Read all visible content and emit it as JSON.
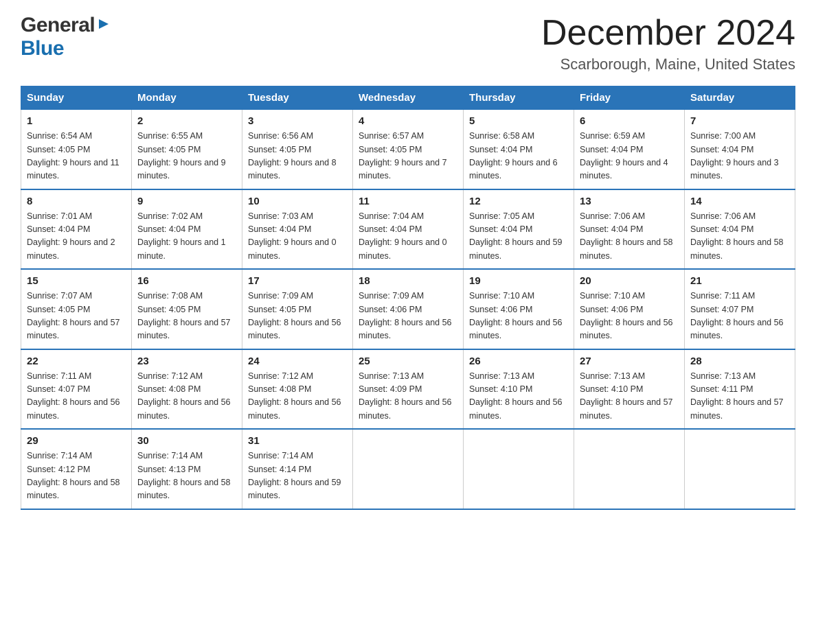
{
  "header": {
    "logo_general": "General",
    "logo_blue": "Blue",
    "month_title": "December 2024",
    "location": "Scarborough, Maine, United States"
  },
  "days_of_week": [
    "Sunday",
    "Monday",
    "Tuesday",
    "Wednesday",
    "Thursday",
    "Friday",
    "Saturday"
  ],
  "weeks": [
    [
      {
        "day": "1",
        "sunrise": "6:54 AM",
        "sunset": "4:05 PM",
        "daylight": "9 hours and 11 minutes."
      },
      {
        "day": "2",
        "sunrise": "6:55 AM",
        "sunset": "4:05 PM",
        "daylight": "9 hours and 9 minutes."
      },
      {
        "day": "3",
        "sunrise": "6:56 AM",
        "sunset": "4:05 PM",
        "daylight": "9 hours and 8 minutes."
      },
      {
        "day": "4",
        "sunrise": "6:57 AM",
        "sunset": "4:05 PM",
        "daylight": "9 hours and 7 minutes."
      },
      {
        "day": "5",
        "sunrise": "6:58 AM",
        "sunset": "4:04 PM",
        "daylight": "9 hours and 6 minutes."
      },
      {
        "day": "6",
        "sunrise": "6:59 AM",
        "sunset": "4:04 PM",
        "daylight": "9 hours and 4 minutes."
      },
      {
        "day": "7",
        "sunrise": "7:00 AM",
        "sunset": "4:04 PM",
        "daylight": "9 hours and 3 minutes."
      }
    ],
    [
      {
        "day": "8",
        "sunrise": "7:01 AM",
        "sunset": "4:04 PM",
        "daylight": "9 hours and 2 minutes."
      },
      {
        "day": "9",
        "sunrise": "7:02 AM",
        "sunset": "4:04 PM",
        "daylight": "9 hours and 1 minute."
      },
      {
        "day": "10",
        "sunrise": "7:03 AM",
        "sunset": "4:04 PM",
        "daylight": "9 hours and 0 minutes."
      },
      {
        "day": "11",
        "sunrise": "7:04 AM",
        "sunset": "4:04 PM",
        "daylight": "9 hours and 0 minutes."
      },
      {
        "day": "12",
        "sunrise": "7:05 AM",
        "sunset": "4:04 PM",
        "daylight": "8 hours and 59 minutes."
      },
      {
        "day": "13",
        "sunrise": "7:06 AM",
        "sunset": "4:04 PM",
        "daylight": "8 hours and 58 minutes."
      },
      {
        "day": "14",
        "sunrise": "7:06 AM",
        "sunset": "4:04 PM",
        "daylight": "8 hours and 58 minutes."
      }
    ],
    [
      {
        "day": "15",
        "sunrise": "7:07 AM",
        "sunset": "4:05 PM",
        "daylight": "8 hours and 57 minutes."
      },
      {
        "day": "16",
        "sunrise": "7:08 AM",
        "sunset": "4:05 PM",
        "daylight": "8 hours and 57 minutes."
      },
      {
        "day": "17",
        "sunrise": "7:09 AM",
        "sunset": "4:05 PM",
        "daylight": "8 hours and 56 minutes."
      },
      {
        "day": "18",
        "sunrise": "7:09 AM",
        "sunset": "4:06 PM",
        "daylight": "8 hours and 56 minutes."
      },
      {
        "day": "19",
        "sunrise": "7:10 AM",
        "sunset": "4:06 PM",
        "daylight": "8 hours and 56 minutes."
      },
      {
        "day": "20",
        "sunrise": "7:10 AM",
        "sunset": "4:06 PM",
        "daylight": "8 hours and 56 minutes."
      },
      {
        "day": "21",
        "sunrise": "7:11 AM",
        "sunset": "4:07 PM",
        "daylight": "8 hours and 56 minutes."
      }
    ],
    [
      {
        "day": "22",
        "sunrise": "7:11 AM",
        "sunset": "4:07 PM",
        "daylight": "8 hours and 56 minutes."
      },
      {
        "day": "23",
        "sunrise": "7:12 AM",
        "sunset": "4:08 PM",
        "daylight": "8 hours and 56 minutes."
      },
      {
        "day": "24",
        "sunrise": "7:12 AM",
        "sunset": "4:08 PM",
        "daylight": "8 hours and 56 minutes."
      },
      {
        "day": "25",
        "sunrise": "7:13 AM",
        "sunset": "4:09 PM",
        "daylight": "8 hours and 56 minutes."
      },
      {
        "day": "26",
        "sunrise": "7:13 AM",
        "sunset": "4:10 PM",
        "daylight": "8 hours and 56 minutes."
      },
      {
        "day": "27",
        "sunrise": "7:13 AM",
        "sunset": "4:10 PM",
        "daylight": "8 hours and 57 minutes."
      },
      {
        "day": "28",
        "sunrise": "7:13 AM",
        "sunset": "4:11 PM",
        "daylight": "8 hours and 57 minutes."
      }
    ],
    [
      {
        "day": "29",
        "sunrise": "7:14 AM",
        "sunset": "4:12 PM",
        "daylight": "8 hours and 58 minutes."
      },
      {
        "day": "30",
        "sunrise": "7:14 AM",
        "sunset": "4:13 PM",
        "daylight": "8 hours and 58 minutes."
      },
      {
        "day": "31",
        "sunrise": "7:14 AM",
        "sunset": "4:14 PM",
        "daylight": "8 hours and 59 minutes."
      },
      null,
      null,
      null,
      null
    ]
  ],
  "labels": {
    "sunrise_prefix": "Sunrise: ",
    "sunset_prefix": "Sunset: ",
    "daylight_prefix": "Daylight: "
  }
}
